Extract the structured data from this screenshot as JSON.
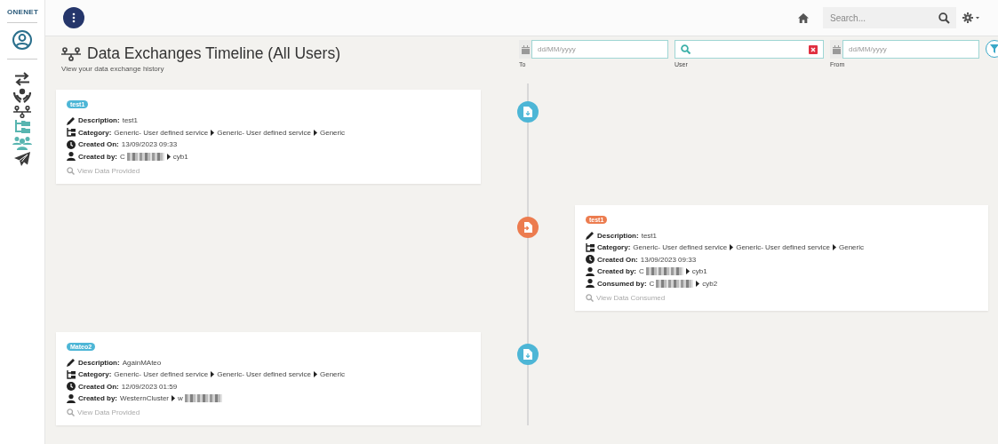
{
  "logo": "ONENET",
  "topbar": {
    "search": {
      "placeholder": "Search..."
    }
  },
  "sidebar": {
    "items": [
      {
        "selected": false
      },
      {
        "selected": false
      },
      {
        "selected": false
      },
      {
        "selected": false
      },
      {
        "selected": true
      },
      {
        "selected": true
      },
      {
        "selected": false
      }
    ]
  },
  "page": {
    "title": "Data Exchanges Timeline (All Users)",
    "subtitle": "View your data exchange history"
  },
  "filters": [
    {
      "kind": "date",
      "placeholder": "dd/MM/yyyy",
      "label": "To"
    },
    {
      "kind": "user",
      "label": "User"
    },
    {
      "kind": "date",
      "placeholder": "dd/MM/yyyy",
      "label": "From"
    }
  ],
  "entries": [
    {
      "kind": "provided",
      "tag": "test1",
      "fields": [
        {
          "kind": "description",
          "label": "Description:",
          "value": "test1"
        },
        {
          "kind": "category",
          "label": "Category:",
          "path": [
            "Generic- User defined service",
            "Generic- User defined service",
            "Generic"
          ]
        },
        {
          "kind": "date",
          "label": "Created On:",
          "value": "13/09/2023 09:33"
        },
        {
          "kind": "user",
          "label": "Created by:",
          "group": "C",
          "member": "cyb1",
          "group_redacted": true,
          "member_redacted": false
        }
      ],
      "link": "View Data Provided"
    },
    {
      "kind": "consumed",
      "tag": "test1",
      "fields": [
        {
          "kind": "description",
          "label": "Description:",
          "value": "test1"
        },
        {
          "kind": "category",
          "label": "Category:",
          "path": [
            "Generic- User defined service",
            "Generic- User defined service",
            "Generic"
          ]
        },
        {
          "kind": "date",
          "label": "Created On:",
          "value": "13/09/2023 09:33"
        },
        {
          "kind": "user",
          "label": "Created by:",
          "group": "C",
          "member": "cyb1",
          "group_redacted": true,
          "member_redacted": false
        },
        {
          "kind": "user",
          "label": "Consumed by:",
          "group": "C",
          "member": "cyb2",
          "group_redacted": true,
          "member_redacted": false
        }
      ],
      "link": "View Data Consumed"
    },
    {
      "kind": "provided",
      "tag": "Mateo2",
      "fields": [
        {
          "kind": "description",
          "label": "Description:",
          "value": "AgainMAteo"
        },
        {
          "kind": "category",
          "label": "Category:",
          "path": [
            "Generic- User defined service",
            "Generic- User defined service",
            "Generic"
          ]
        },
        {
          "kind": "date",
          "label": "Created On:",
          "value": "12/09/2023 01:59"
        },
        {
          "kind": "user",
          "label": "Created by:",
          "group": "WesternCluster",
          "member": "w",
          "group_redacted": false,
          "member_redacted": true
        }
      ],
      "link": "View Data Provided"
    }
  ]
}
